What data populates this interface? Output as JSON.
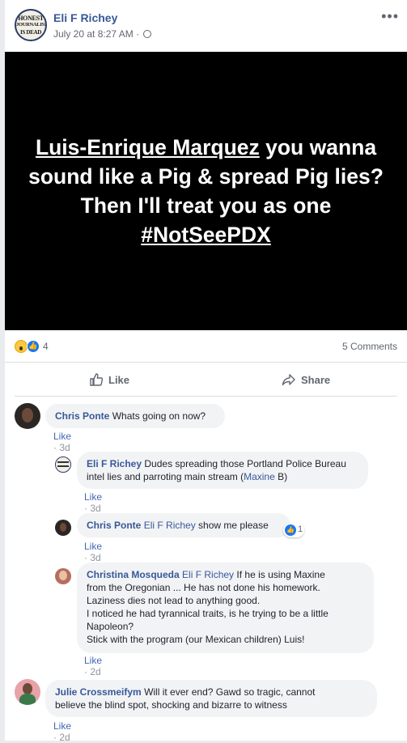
{
  "post": {
    "author": "Eli F Richey",
    "timestamp": "July 20 at 8:27 AM",
    "separator": "·",
    "avatar_text": [
      "HONEST",
      "JOURNALISM",
      "IS DEAD"
    ],
    "more_label": "•••",
    "image_text": {
      "mention": "Luis-Enrique Marquez",
      "body": " you wanna sound like a Pig & spread Pig lies? Then I'll treat you as one",
      "hashtag": "#NotSeePDX"
    }
  },
  "reactions": {
    "icons": [
      "wow-icon",
      "like-icon"
    ],
    "count": "4",
    "comments": "5 Comments"
  },
  "actions": {
    "like": "Like",
    "share": "Share"
  },
  "comments": [
    {
      "name": "Chris Ponte",
      "text": "Whats going on now?",
      "like": "Like",
      "time": "3d"
    },
    {
      "name": "Eli F Richey",
      "text": "Dudes spreading those Portland Police Bureau intel lies and parroting main stream (",
      "tag": "Maxine",
      "text_after": " B)",
      "like": "Like",
      "time": "3d"
    },
    {
      "name": "Chris Ponte",
      "tag": "Eli F Richey",
      "text": "show me please",
      "reaction_count": "1",
      "like": "Like",
      "time": "3d"
    },
    {
      "name": "Christina Mosqueda",
      "tag": "Eli F Richey",
      "text_lines": [
        "If he is using Maxine",
        "from the Oregonian ... He has not done his homework.",
        "Laziness dies not lead to anything good.",
        "I noticed he had tyrannical traits, is he trying to be a little",
        "Napoleon?",
        "Stick with the program (our Mexican children) Luis!"
      ],
      "like": "Like",
      "time": "2d"
    },
    {
      "name": "Julie Crossmeifym",
      "text": "Will it ever end? Gawd so tragic, cannot",
      "text_line2": "believe the blind spot, shocking and bizarre to witness",
      "like": "Like",
      "time": "2d"
    }
  ],
  "colors": {
    "link_blue": "#385898",
    "like_blue": "#1877f2",
    "bubble_gray": "#f2f3f5",
    "meta_gray": "#90949c"
  }
}
